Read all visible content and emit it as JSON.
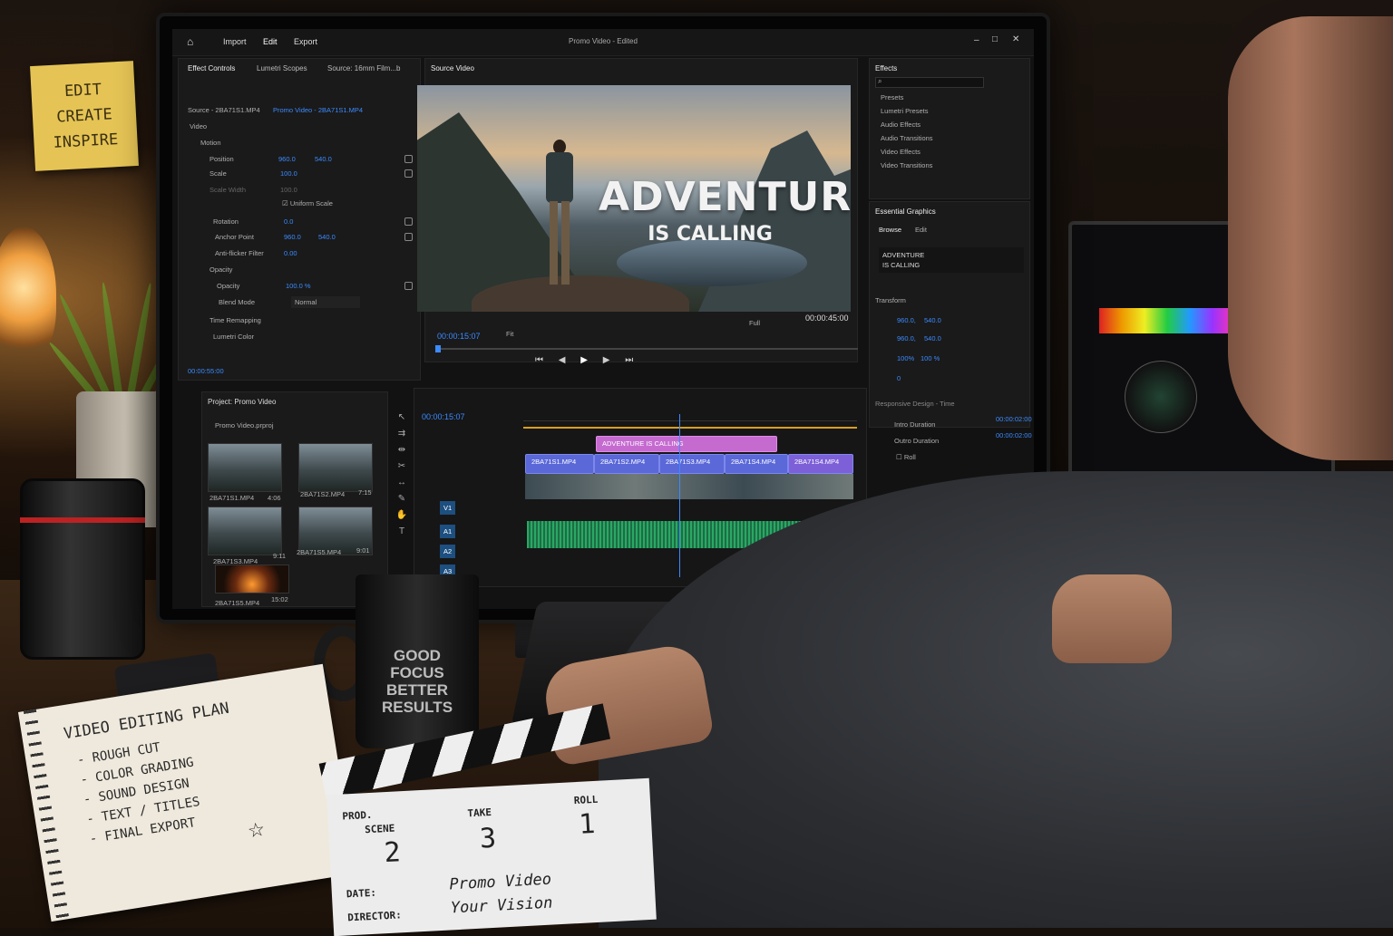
{
  "app": {
    "menu": [
      "Import",
      "Edit",
      "Export"
    ],
    "title": "Promo Video - Edited"
  },
  "effect_controls": {
    "tabs": [
      "Effect Controls",
      "Lumetri Scopes",
      "Source: 16mm Film...b"
    ],
    "source": "Source - 2BA71S1.MP4",
    "sequence": "Promo Video - 2BA71S1.MP4",
    "section_video": "Video",
    "motion": "Motion",
    "position_label": "Position",
    "position_x": "960.0",
    "position_y": "540.0",
    "scale_label": "Scale",
    "scale_value": "100.0",
    "scale_width_label": "Scale Width",
    "scale_width_value": "100.0",
    "uniform_scale": "Uniform Scale",
    "rotation_label": "Rotation",
    "rotation_value": "0.0",
    "anchor_label": "Anchor Point",
    "anchor_x": "960.0",
    "anchor_y": "540.0",
    "antiflicker_label": "Anti-flicker Filter",
    "antiflicker_value": "0.00",
    "opacity_section": "Opacity",
    "opacity_label": "Opacity",
    "opacity_value": "100.0 %",
    "blend_label": "Blend Mode",
    "blend_value": "Normal",
    "time_remap": "Time Remapping",
    "lumetri": "Lumetri Color",
    "timecode": "00:00:55:00"
  },
  "program": {
    "tab": "Source Video",
    "title_line1": "ADVENTURE",
    "title_line2": "IS CALLING",
    "timecode_current": "00:00:15:07",
    "fit": "Fit",
    "quality": "Full",
    "timecode_total": "00:00:45:00"
  },
  "effects": {
    "title": "Effects",
    "items": [
      "Presets",
      "Lumetri Presets",
      "Audio Effects",
      "Audio Transitions",
      "Video Effects",
      "Video Transitions"
    ]
  },
  "essential_graphics": {
    "title": "Essential Graphics",
    "tabs": [
      "Browse",
      "Edit"
    ],
    "layer_line1": "ADVENTURE",
    "layer_line2": "IS CALLING",
    "transform": "Transform",
    "pos_x": "960.0,",
    "pos_y": "540.0",
    "anchor_x": "960.0,",
    "anchor_y": "540.0",
    "scale_a": "100%",
    "scale_b": "100 %",
    "rotation": "0",
    "responsive": "Responsive Design - Time",
    "intro_label": "Intro Duration",
    "intro_value": "00:00:02:00",
    "outro_label": "Outro Duration",
    "outro_value": "00:00:02:00",
    "roll": "Roll"
  },
  "project": {
    "title": "Project: Promo Video",
    "file": "Promo Video.prproj",
    "clips": [
      {
        "name": "2BA71S1.MP4",
        "dur": "4:06"
      },
      {
        "name": "2BA71S2.MP4",
        "dur": "7:15"
      },
      {
        "name": "2BA71S3.MP4",
        "dur": "9:11"
      },
      {
        "name": "2BA71S5.MP4",
        "dur": "9:01"
      },
      {
        "name": "2BA71S5.MP4",
        "dur": "15:02"
      }
    ]
  },
  "timeline": {
    "timecode": "00:00:15:07",
    "tracks": [
      "V1",
      "A1",
      "A2",
      "A3"
    ],
    "title_clip": "ADVENTURE IS CALLING",
    "clips": [
      "2BA71S1.MP4",
      "2BA71S2.MP4",
      "2BA71S3.MP4",
      "2BA71S4.MP4",
      "2BA71S4.MP4"
    ]
  },
  "desk": {
    "sticky": [
      "EDIT",
      "CREATE",
      "INSPIRE"
    ],
    "mug": [
      "GOOD",
      "FOCUS",
      "BETTER",
      "RESULTS"
    ],
    "notebook_title": "VIDEO EDITING PLAN",
    "notebook_items": [
      "- ROUGH CUT",
      "- COLOR GRADING",
      "- SOUND DESIGN",
      "- TEXT / TITLES",
      "- FINAL EXPORT"
    ],
    "clapper": {
      "prod": "PROD.",
      "scene": "SCENE",
      "scene_value": "2",
      "take": "TAKE",
      "take_value": "3",
      "roll": "ROLL",
      "roll_value": "1",
      "date": "DATE:",
      "date_value": "Promo Video",
      "director": "DIRECTOR:",
      "director_value": "Your Vision"
    }
  }
}
